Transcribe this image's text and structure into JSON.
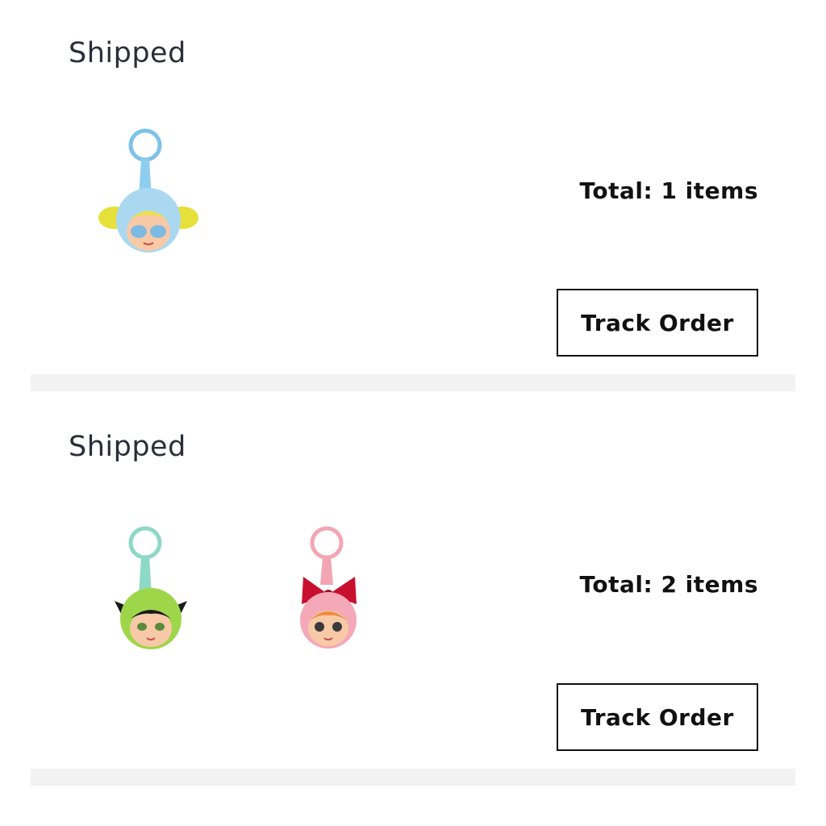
{
  "orders": [
    {
      "status": "Shipped",
      "total": "Total: 1 items",
      "track_label": "Track Order",
      "products": [
        {
          "icon": "blue-keychain-plush-icon",
          "color": "#a9d8f0"
        }
      ]
    },
    {
      "status": "Shipped",
      "total": "Total: 2 items",
      "track_label": "Track Order",
      "products": [
        {
          "icon": "green-keychain-plush-icon",
          "color": "#9ed64a"
        },
        {
          "icon": "pink-keychain-plush-icon",
          "color": "#f4a8b8"
        }
      ]
    }
  ],
  "colors": {
    "divider": "#f2f2f2",
    "status_text": "#2b2d3a",
    "button_border": "#111111"
  }
}
